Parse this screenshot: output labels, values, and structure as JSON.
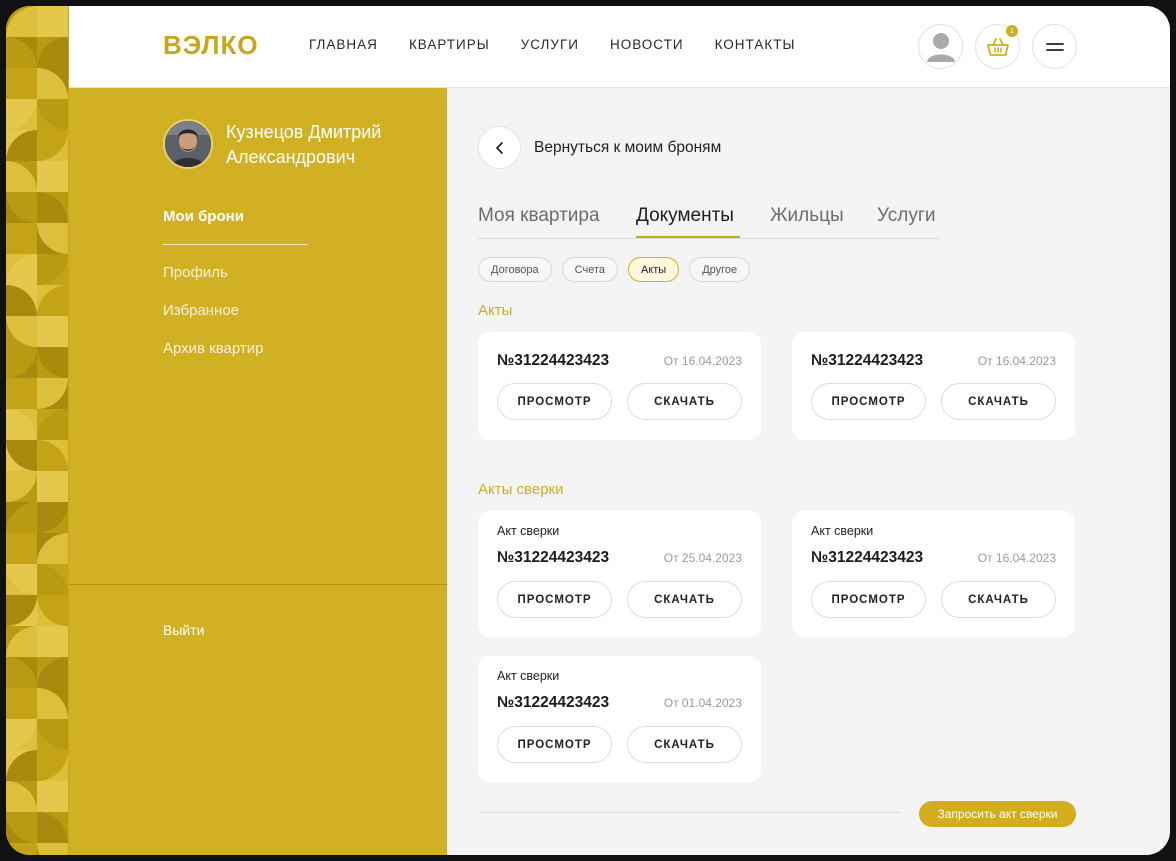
{
  "brand": {
    "logo": "ВЭЛКО",
    "accent": "#d2ad1e"
  },
  "nav": [
    "ГЛАВНАЯ",
    "КВАРТИРЫ",
    "УСЛУГИ",
    "НОВОСТИ",
    "КОНТАКТЫ"
  ],
  "header": {
    "cart_badge": "1",
    "icons": [
      "user-icon",
      "basket-icon",
      "menu-icon"
    ]
  },
  "sidebar": {
    "user_name": "Кузнецов Дмитрий Александрович",
    "active_item": "Мои брони",
    "items": [
      "Профиль",
      "Избранное",
      "Архив квартир"
    ],
    "logout": "Выйти"
  },
  "main": {
    "back_label": "Вернуться к моим броням",
    "tabs": [
      "Моя квартира",
      "Документы",
      "Жильцы",
      "Услуги"
    ],
    "active_tab": "Документы",
    "chips": [
      "Договора",
      "Счета",
      "Акты",
      "Другое"
    ],
    "active_chip": "Акты",
    "section_acts": "Акты",
    "section_reconciliation": "Акты сверки",
    "view_label": "ПРОСМОТР",
    "download_label": "СКАЧАТЬ",
    "acts": [
      {
        "number": "№31224423423",
        "date": "От 16.04.2023"
      },
      {
        "number": "№31224423423",
        "date": "От 16.04.2023"
      }
    ],
    "reconciliation": [
      {
        "caption": "Акт сверки",
        "number": "№31224423423",
        "date": "От 25.04.2023"
      },
      {
        "caption": "Акт сверки",
        "number": "№31224423423",
        "date": "От 16.04.2023"
      },
      {
        "caption": "Акт сверки",
        "number": "№31224423423",
        "date": "От 01.04.2023"
      }
    ],
    "request_button": "Запросить акт сверки"
  }
}
